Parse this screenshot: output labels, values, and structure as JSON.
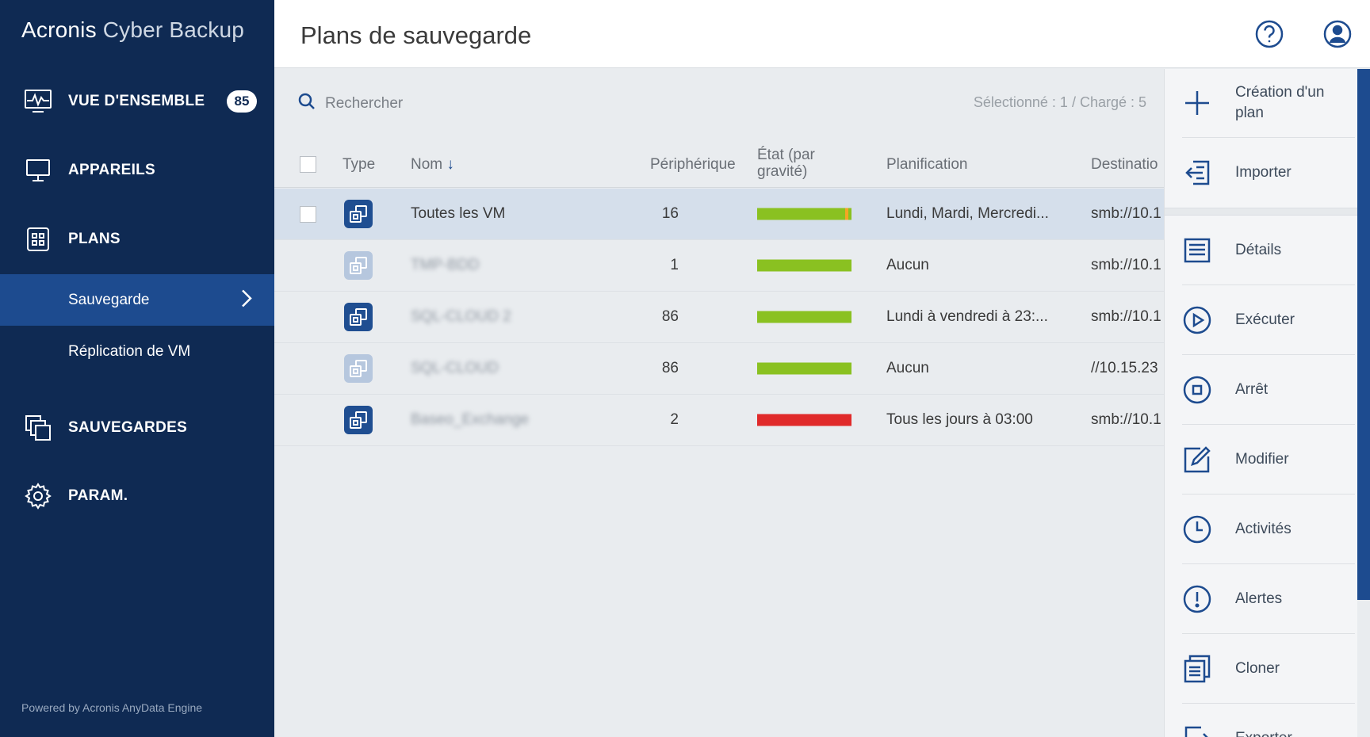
{
  "brand": {
    "part1": "Acronis",
    "part2": "Cyber Backup"
  },
  "sidebar": {
    "items": [
      {
        "label": "VUE D'ENSEMBLE",
        "icon": "overview-icon",
        "badge": "85"
      },
      {
        "label": "APPAREILS",
        "icon": "monitor-icon"
      },
      {
        "label": "PLANS",
        "icon": "plans-icon"
      },
      {
        "label": "SAUVEGARDES",
        "icon": "backups-icon"
      },
      {
        "label": "PARAM.",
        "icon": "gear-icon"
      }
    ],
    "sub_items": [
      {
        "label": "Sauvegarde",
        "active": true
      },
      {
        "label": "Réplication de VM",
        "active": false
      }
    ],
    "powered_by": "Powered by Acronis AnyData Engine"
  },
  "header": {
    "title": "Plans de sauvegarde",
    "icons": [
      "help-icon",
      "user-icon"
    ]
  },
  "main": {
    "search_placeholder": "Rechercher",
    "selection_info": "Sélectionné : 1 / Chargé : 5",
    "columns": [
      "Type",
      "Nom",
      "Périphérique",
      "État (par gravité)",
      "Planification",
      "Destinatio"
    ],
    "rows": [
      {
        "name": "Toutes les VM",
        "devices": "16",
        "schedule": "Lundi, Mardi, Mercredi...",
        "destination": "smb://10.1",
        "state": "ok-warning",
        "selected": true,
        "blurred": false
      },
      {
        "name": "TMP-BDD",
        "devices": "1",
        "schedule": "Aucun",
        "destination": "smb://10.1",
        "state": "ok",
        "selected": false,
        "blurred": true
      },
      {
        "name": "SQL-CLOUD 2",
        "devices": "86",
        "schedule": "Lundi à vendredi à 23:...",
        "destination": "smb://10.1",
        "state": "ok",
        "selected": false,
        "blurred": true
      },
      {
        "name": "SQL-CLOUD",
        "devices": "86",
        "schedule": "Aucun",
        "destination": "//10.15.23",
        "state": "ok",
        "selected": false,
        "blurred": true
      },
      {
        "name": "Baseo_Exchange",
        "devices": "2",
        "schedule": "Tous les jours à 03:00",
        "destination": "smb://10.1",
        "state": "error",
        "selected": false,
        "blurred": true
      }
    ]
  },
  "actions": [
    {
      "label": "Création d'un plan",
      "icon": "plus-icon"
    },
    {
      "label": "Importer",
      "icon": "import-icon"
    },
    {
      "label": "Détails",
      "icon": "details-icon"
    },
    {
      "label": "Exécuter",
      "icon": "play-icon"
    },
    {
      "label": "Arrêt",
      "icon": "stop-icon"
    },
    {
      "label": "Modifier",
      "icon": "edit-icon"
    },
    {
      "label": "Activités",
      "icon": "clock-icon"
    },
    {
      "label": "Alertes",
      "icon": "alert-icon"
    },
    {
      "label": "Cloner",
      "icon": "clone-icon"
    },
    {
      "label": "Exporter",
      "icon": "export-icon"
    }
  ],
  "colors": {
    "sidebar": "#0f2a53",
    "accent": "#1d4b8f",
    "ok": "#8ac121",
    "warning": "#f5a623",
    "error": "#e02a2a"
  }
}
